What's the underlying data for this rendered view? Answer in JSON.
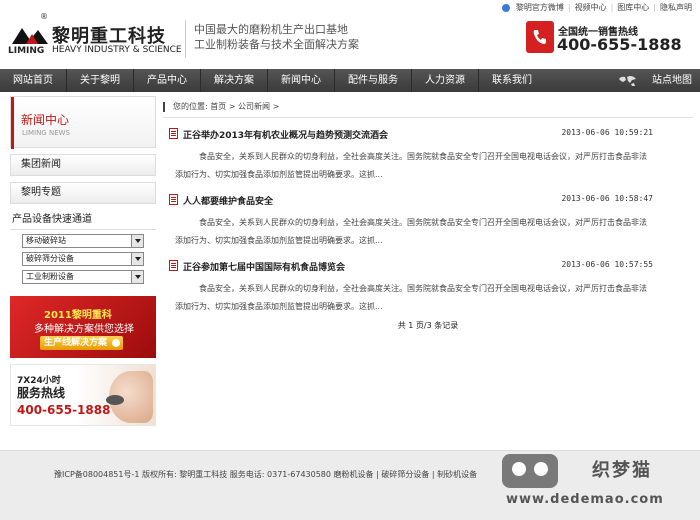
{
  "header": {
    "logo_cn": "黎明重工科技",
    "logo_en_left": "LIMING",
    "logo_en_right": "HEAVY INDUSTRY & SCIENCE",
    "logo_reg": "®",
    "slogan_line1": "中国最大的磨粉机生产出口基地",
    "slogan_line2": "工业制粉装备与技术全面解决方案",
    "toplinks": {
      "weibo": "黎明官方微博",
      "video": "视频中心",
      "gallery": "图库中心",
      "privacy": "隐私声明"
    },
    "hotline_label": "全国统一销售热线",
    "hotline_number": "400-655-1888"
  },
  "nav": {
    "items": [
      "网站首页",
      "关于黎明",
      "产品中心",
      "解决方案",
      "新闻中心",
      "配件与服务",
      "人力资源",
      "联系我们"
    ],
    "sitemap": "站点地图"
  },
  "sidebar": {
    "news_title_cn": "新闻中心",
    "news_title_en": "LIMING NEWS",
    "group_news": "集团新闻",
    "special": "黎明专题",
    "quick_title": "产品设备快速通道",
    "selects": [
      "移动破碎站",
      "破碎筛分设备",
      "工业制粉设备"
    ],
    "ad1": {
      "top": "2011黎明重科",
      "mid": "多种解决方案供您选择",
      "button": "生产线解决方案"
    },
    "ad2": {
      "line1": "7X24小时",
      "line2": "服务热线",
      "line3": "400-655-1888"
    }
  },
  "main": {
    "breadcrumb": "您的位置: 首页 > 公司新闻 >",
    "news": [
      {
        "title": "正谷举办2013年有机农业概况与趋势预测交流酒会",
        "date": "2013-06-06 10:59:21",
        "summary": "食品安全，关系到人民群众的切身利益，全社会高度关注。国务院就食品安全专门召开全国电视电话会议，对严厉打击食品非法添加行为、切实加强食品添加剂监管提出明确要求。这抓..."
      },
      {
        "title": "人人都要维护食品安全",
        "date": "2013-06-06 10:58:47",
        "summary": "食品安全，关系到人民群众的切身利益，全社会高度关注。国务院就食品安全专门召开全国电视电话会议，对严厉打击食品非法添加行为、切实加强食品添加剂监管提出明确要求。这抓..."
      },
      {
        "title": "正谷参加第七届中国国际有机食品博览会",
        "date": "2013-06-06 10:57:55",
        "summary": "食品安全，关系到人民群众的切身利益，全社会高度关注。国务院就食品安全专门召开全国电视电话会议，对严厉打击食品非法添加行为、切实加强食品添加剂监管提出明确要求。这抓..."
      }
    ],
    "pager": "共 1 页/3 条记录"
  },
  "footer": {
    "text": "豫ICP备08004851号-1  版权所有: 黎明重工科技  服务电话: 0371-67430580  磨粉机设备 | 破碎筛分设备 | 制砂机设备"
  },
  "watermark": {
    "name": "织梦猫",
    "url": "www.dedemao.com"
  },
  "colors": {
    "brand_red": "#c01818",
    "nav_bg": "#3a3a3a"
  }
}
